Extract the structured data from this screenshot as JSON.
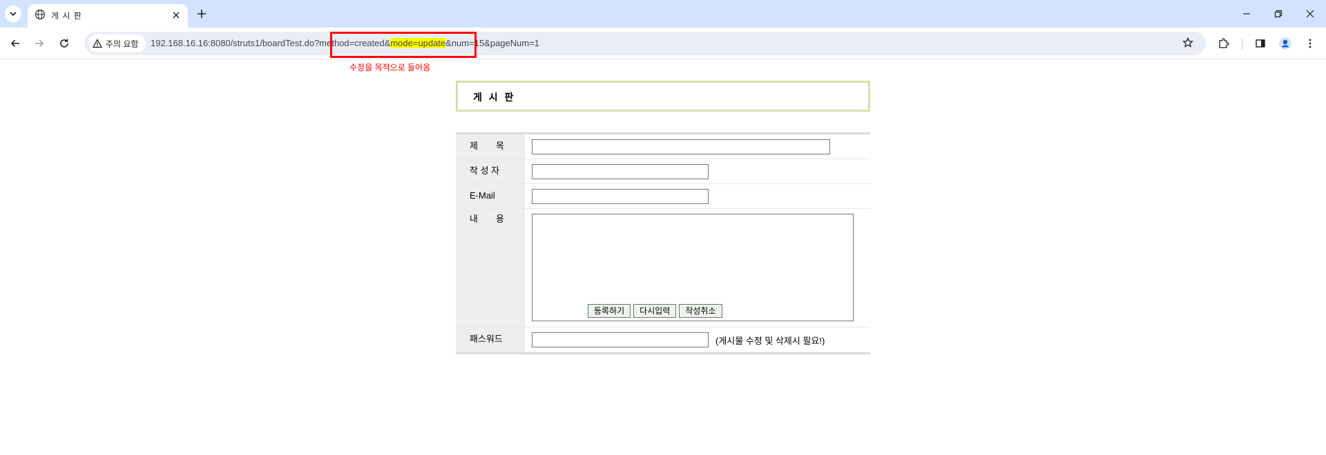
{
  "tab": {
    "title": "게 시 판",
    "favicon": "globe-icon"
  },
  "window_controls": [
    "minimize-icon",
    "restore-icon",
    "close-icon"
  ],
  "toolbar": {
    "security_label": "주의 요함",
    "url_before": "192.168.16.16:8080/struts1/boardTest.do?method=created&",
    "url_highlight": "mode=update",
    "url_after": "&num=15&pageNum=1"
  },
  "annotation": {
    "text": "수정을 목적으로 들어옴",
    "color": "#ff0000"
  },
  "board": {
    "title": "게 시 판"
  },
  "form": {
    "subject_label": "제　　목",
    "writer_label": "작 성 자",
    "email_label": "E-Mail",
    "content_label": "내　　용",
    "password_label": "패스워드",
    "password_hint": "(게시물 수정 및 삭제시 필요!)",
    "subject_value": "",
    "writer_value": "",
    "email_value": "",
    "content_value": "",
    "password_value": ""
  },
  "buttons": {
    "submit": "등록하기",
    "reset": "다시입력",
    "cancel": "작성취소"
  },
  "colors": {
    "tabstrip_bg": "#d3e3fd",
    "omnibox_bg": "#e9eef6",
    "title_border": "#dbdbb0",
    "label_bg": "#eeeeee",
    "highlight": "#ffff00"
  }
}
